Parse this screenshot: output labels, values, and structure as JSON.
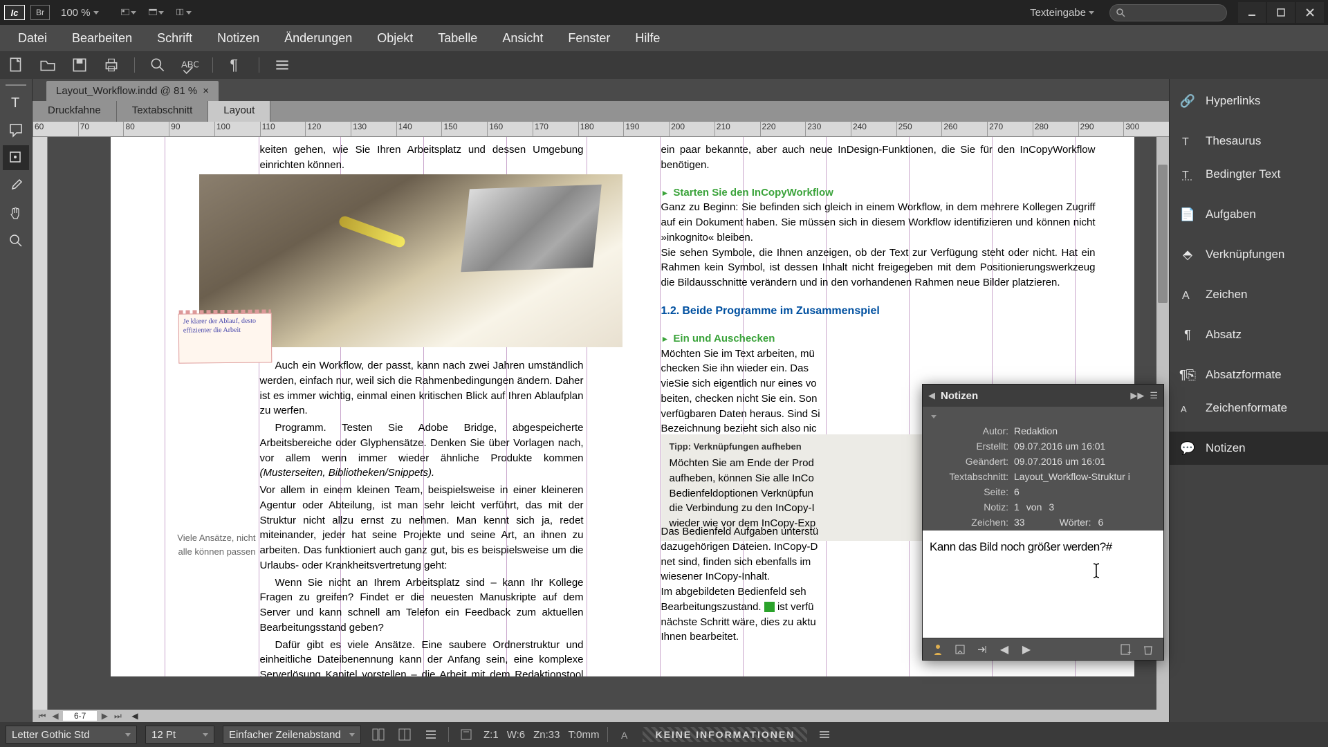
{
  "titlebar": {
    "app_abbr": "Ic",
    "bridge_abbr": "Br",
    "zoom": "100 %",
    "workspace_label": "Texteingabe"
  },
  "menu": {
    "items": [
      "Datei",
      "Bearbeiten",
      "Schrift",
      "Notizen",
      "Änderungen",
      "Objekt",
      "Tabelle",
      "Ansicht",
      "Fenster",
      "Hilfe"
    ]
  },
  "doc_tab": "Layout_Workflow.indd @ 81 %",
  "view_tabs": [
    "Druckfahne",
    "Textabschnitt",
    "Layout"
  ],
  "ruler": [
    "60",
    "70",
    "80",
    "90",
    "100",
    "110",
    "120",
    "130",
    "140",
    "150",
    "160",
    "170",
    "180",
    "190",
    "200",
    "210",
    "220",
    "230",
    "240",
    "250",
    "260",
    "270",
    "280",
    "290",
    "300"
  ],
  "page1": {
    "top": "keiten gehen, wie Sie Ihren Arbeitsplatz und dessen Umgebung einrichten können.",
    "sticky": "Je klarer der Ablauf, desto effizienter die Arbeit",
    "side_note": "Viele Ansätze, nicht alle können passen",
    "p1": "Auch ein Workflow, der passt, kann nach zwei Jahren umständlich werden, einfach nur, weil sich die Rahmenbedingungen ändern. Daher ist es immer wichtig, einmal einen kritischen Blick auf Ihren Ablaufplan zu werfen.",
    "p2": "Programm. Testen Sie Adobe Bridge, abgespeicherte Arbeitsbereiche oder Glyphensätze. Denken Sie über Vorlagen nach, vor allem wenn immer wieder ähnliche Produkte kommen ",
    "p2_em": "(Musterseiten, Bibliotheken/Snippets).",
    "p3": "Vor allem in einem kleinen Team, beispielsweise in einer kleineren Agentur oder Abteilung, ist man sehr leicht verführt, das mit der Struktur nicht allzu ernst zu nehmen. Man kennt sich ja, redet miteinander, jeder hat seine Projekte und seine Art, an ihnen zu arbeiten. Das funktioniert auch ganz gut, bis es beispielsweise um die Urlaubs- oder Krankheitsvertretung geht:",
    "p4": "Wenn Sie nicht an Ihrem Arbeitsplatz sind – kann Ihr Kollege Fragen zu greifen? Findet er die neuesten Manuskripte auf dem Server und kann schnell am Telefon ein Feedback zum aktuellen Bearbeitungsstand geben?",
    "p5": "Dafür gibt es viele Ansätze. Eine saubere Ordnerstruktur und einheitliche Dateibenennung kann der Anfang sein, eine komplexe Serverlösung Kapitel vorstellen – die Arbeit mit dem Redaktionstool Adobe InCopy und die darauf basierenden Serverlösungen."
  },
  "page2": {
    "top": "ein paar bekannte, aber auch neue InDesign-Funktionen, die Sie für den InCopyWorkflow benötigen.",
    "h1": "Starten Sie den InCopyWorkflow",
    "p1": "Ganz zu Beginn: Sie befinden sich gleich in einem Workflow, in dem mehrere Kollegen Zugriff auf ein Dokument haben. Sie müssen sich in diesem Workflow identifizieren und können nicht »inkognito« bleiben.",
    "p2": "Sie sehen Symbole, die Ihnen anzeigen, ob der Text zur Verfügung steht oder nicht. Hat ein Rahmen kein Symbol, ist dessen Inhalt nicht freigegeben mit dem Positionierungswerkzeug die Bildausschnitte verändern und in den vorhandenen Rahmen neue Bilder platzieren.",
    "h2_num": "1.2.",
    "h2": "Beide Programme im Zusammenspiel",
    "h3": "Ein und Auschecken",
    "p3": "Möchten Sie im Text arbeiten, mü\nchecken Sie ihn wieder ein. Das \nvieSie sich eigentlich nur eines vo\nbeiten, checken nicht Sie ein. Son\nverfügbaren Daten heraus. Sind Si\nBezeichnung bezieht sich also nic",
    "box_title": "Tipp: Verknüpfungen aufheben",
    "box_body": "Möchten Sie am Ende der Prod\naufheben, können Sie alle InCo\nBedienfeldoptionen Verknüpfun\ndie Verbindung zu den InCopy-I\nwieder wie vor dem InCopy-Exp",
    "p4": "Das Bedienfeld Aufgaben unterstü\ndazugehörigen Dateien. InCopy-D\nnet sind, finden sich ebenfalls im\nwiesener InCopy-Inhalt.",
    "p5a": "Im abgebildeten Bedienfeld seh\nBearbeitungszustand. ",
    "p5b": " ist verfü\nnächste Schritt wäre, dies zu aktu\nIhnen bearbeitet."
  },
  "notes": {
    "title": "Notizen",
    "author_l": "Autor:",
    "author": "Redaktion",
    "created_l": "Erstellt:",
    "created": "09.07.2016 um 16:01",
    "modified_l": "Geändert:",
    "modified": "09.07.2016 um 16:01",
    "story_l": "Textabschnitt:",
    "story": "Layout_Workflow-Struktur i",
    "page_l": "Seite:",
    "page": "6",
    "note_l": "Notiz:",
    "note_num": "1",
    "note_of": "von",
    "note_total": "3",
    "chars_l": "Zeichen:",
    "chars": "33",
    "words_l": "Wörter:",
    "words": "6",
    "content": "Kann das Bild noch größer werden?#"
  },
  "right_panel": {
    "items": [
      "Hyperlinks",
      "Thesaurus",
      "Bedingter Text",
      "Aufgaben",
      "Verknüpfungen",
      "Zeichen",
      "Absatz",
      "Absatzformate",
      "Zeichenformate",
      "Notizen"
    ]
  },
  "nav": {
    "page": "6-7"
  },
  "status": {
    "font": "Letter Gothic Std",
    "size": "12 Pt",
    "leading": "Einfacher Zeilenabstand",
    "line": "Z:1",
    "words": "W:6",
    "chars": "Zn:33",
    "tracking": "T:0mm",
    "info": "KEINE INFORMATIONEN"
  }
}
